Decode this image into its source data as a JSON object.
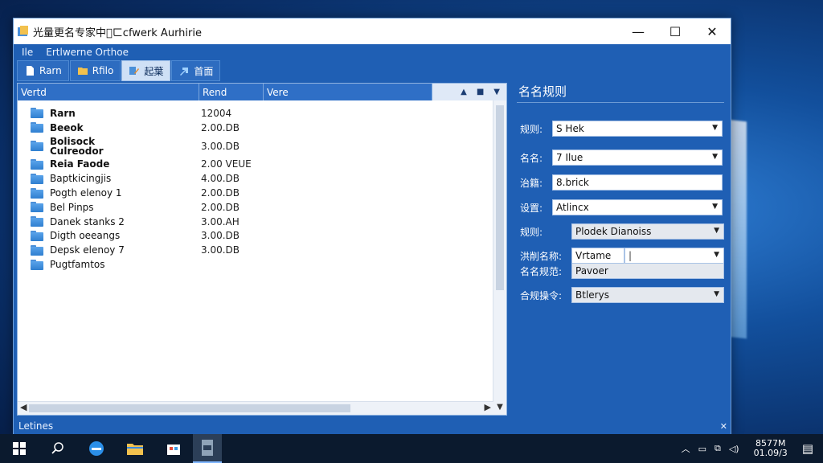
{
  "window": {
    "title": "光量更名专家中\u0000ㄈcfwerk Aurhirie",
    "controls": {
      "minimize": "—",
      "maximize": "☐",
      "close": "✕"
    }
  },
  "menu": {
    "items": [
      "Ile",
      "Ertlwerne Orthoe"
    ]
  },
  "toolbar": {
    "buttons": [
      {
        "label": "Rarn",
        "icon": "file-icon"
      },
      {
        "label": "Rfilo",
        "icon": "folder-icon"
      },
      {
        "label": "起葉",
        "icon": "edit-icon",
        "active": true
      },
      {
        "label": "首面",
        "icon": "arrow-icon"
      }
    ]
  },
  "file_list": {
    "columns": [
      "Vertd",
      "Rend",
      "Vere"
    ],
    "rows": [
      {
        "name": "Rarn",
        "size": "12004",
        "bold": true
      },
      {
        "name": "Beeok",
        "size": "2.00.DB",
        "bold": true
      },
      {
        "name": "Bolisock\nCulreodor",
        "size": "3.00.DB",
        "bold": true
      },
      {
        "name": "Reia Faode",
        "size": "2.00 VEUE",
        "bold": true
      },
      {
        "name": "Baptkicingjis",
        "size": "4.00.DB",
        "bold": false
      },
      {
        "name": "Pogth elenoy 1",
        "size": "2.00.DB",
        "bold": false
      },
      {
        "name": "Bel Pinps",
        "size": "2.00.DB",
        "bold": false
      },
      {
        "name": "Danek stanks 2",
        "size": "3.00.AH",
        "bold": false
      },
      {
        "name": "Digth oeeangs",
        "size": "3.00.DB",
        "bold": false
      },
      {
        "name": "Depsk elenoy 7",
        "size": "3.00.DB",
        "bold": false
      },
      {
        "name": "Pugtfamtos",
        "size": "",
        "bold": false
      }
    ]
  },
  "status": {
    "text": "Letines",
    "close": "✕"
  },
  "panel": {
    "title": "名名规则",
    "fields": [
      {
        "label": "规则:",
        "value": "S Hek",
        "dropdown": true
      },
      {
        "label": "名名:",
        "value": "7 Ilue",
        "dropdown": true
      },
      {
        "label": "治籍:",
        "value": "8.brick",
        "dropdown": false
      },
      {
        "label": "设置:",
        "value": "Atlincx",
        "dropdown": true
      },
      {
        "label": "规则:",
        "value": "Plodek Dianoiss",
        "dropdown": true
      },
      {
        "label": "洪削名称:",
        "value": "Vrtame",
        "dropdown": true
      },
      {
        "label": "名名规范:",
        "value": "Pavoer",
        "dropdown": false
      },
      {
        "label": "合规操令:",
        "value": "Btlerys",
        "dropdown": true
      }
    ]
  },
  "taskbar": {
    "clock_time": "8577M",
    "clock_date": "01.09/3"
  },
  "colors": {
    "accent": "#1f5fb4",
    "window_bg": "#ffffff",
    "taskbar": "#0b1a2e"
  }
}
